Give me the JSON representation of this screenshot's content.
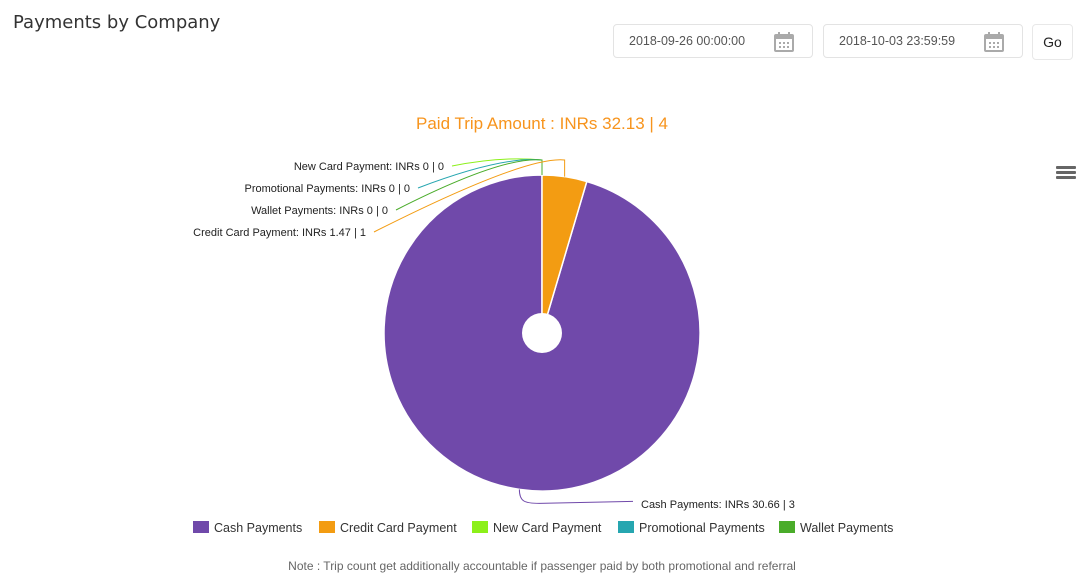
{
  "page": {
    "title": "Payments by Company"
  },
  "filters": {
    "from_date": "2018-09-26 00:00:00",
    "to_date": "2018-10-03 23:59:59",
    "go_label": "Go",
    "calendar_icon": "calendar-icon"
  },
  "menu_icon": "hamburger-menu-icon",
  "chart_data": {
    "type": "pie",
    "title": "Paid Trip Amount : INRs 32.13 | 4",
    "title_color": "#f7941d",
    "currency": "INRs",
    "inner_hole": true,
    "legend_position": "bottom",
    "slices": [
      {
        "name": "Cash Payments",
        "value": 30.66,
        "count": 3,
        "color": "#7049aa",
        "label": "Cash Payments: INRs 30.66 | 3"
      },
      {
        "name": "Credit Card Payment",
        "value": 1.47,
        "count": 1,
        "color": "#f39c12",
        "label": "Credit Card Payment: INRs 1.47 | 1"
      },
      {
        "name": "New Card Payment",
        "value": 0,
        "count": 0,
        "color": "#8cf01a",
        "label": "New Card Payment: INRs 0 | 0"
      },
      {
        "name": "Promotional Payments",
        "value": 0,
        "count": 0,
        "color": "#26a6b0",
        "label": "Promotional Payments: INRs 0 | 0"
      },
      {
        "name": "Wallet Payments",
        "value": 0,
        "count": 0,
        "color": "#4aac2a",
        "label": "Wallet Payments: INRs 0 | 0"
      }
    ]
  },
  "note": "Note : Trip count get additionally accountable if passenger paid by both promotional and referral"
}
